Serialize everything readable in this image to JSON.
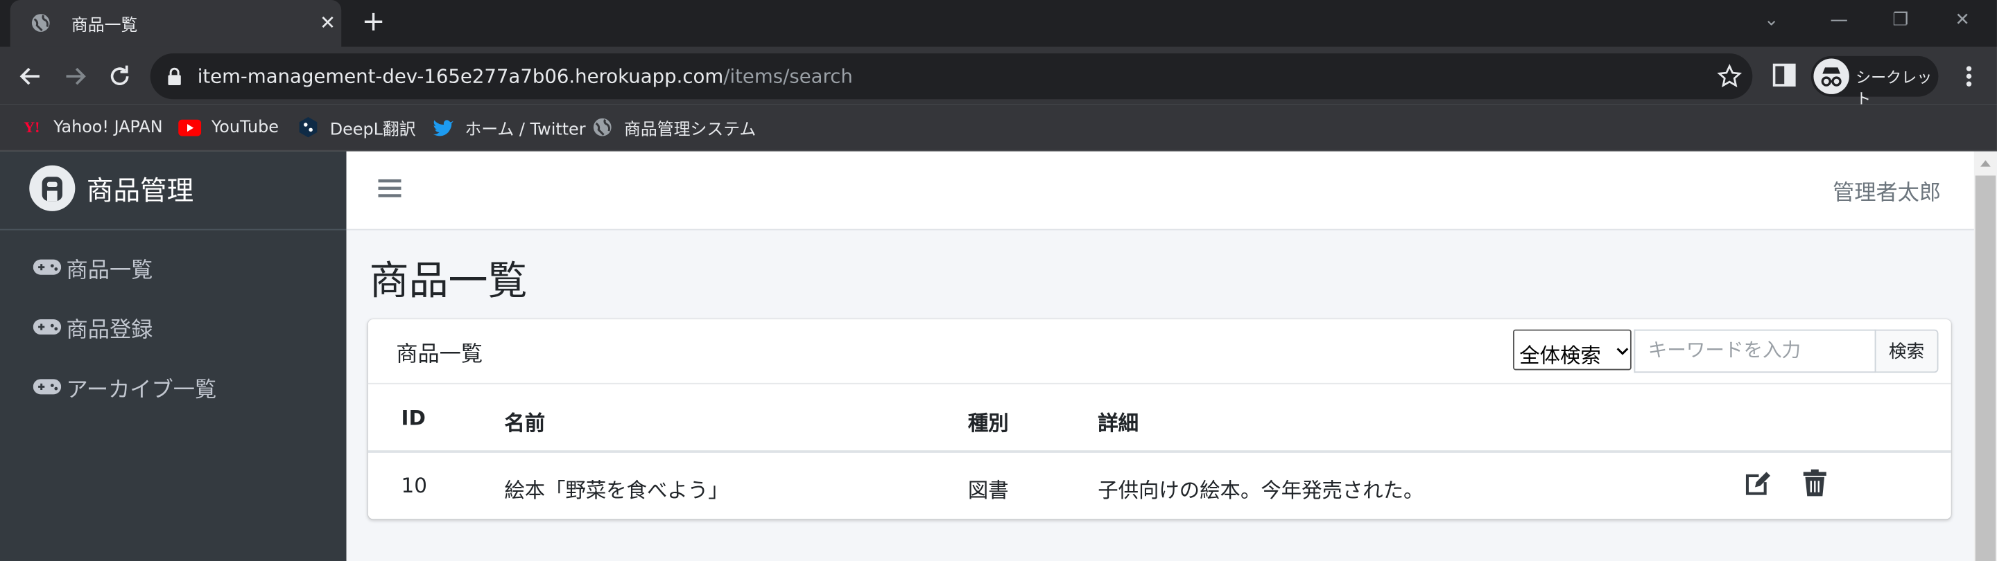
{
  "browser": {
    "tab_title": "商品一覧",
    "url_host": "item-management-dev-165e277a7b06.herokuapp.com",
    "url_path": "/items/search",
    "profile_label": "シークレット"
  },
  "bookmarks": [
    {
      "label": "Yahoo! JAPAN",
      "icon": "yahoo-icon"
    },
    {
      "label": "YouTube",
      "icon": "youtube-icon"
    },
    {
      "label": "DeepL翻訳",
      "icon": "deepl-icon"
    },
    {
      "label": "ホーム / Twitter",
      "icon": "twitter-icon"
    },
    {
      "label": "商品管理システム",
      "icon": "globe-icon"
    }
  ],
  "sidebar": {
    "brand": "商品管理",
    "items": [
      {
        "label": "商品一覧",
        "icon": "gamepad-icon"
      },
      {
        "label": "商品登録",
        "icon": "gamepad-icon"
      },
      {
        "label": "アーカイブ一覧",
        "icon": "gamepad-icon"
      }
    ]
  },
  "header": {
    "user_name": "管理者太郎"
  },
  "main": {
    "page_title": "商品一覧",
    "card_title": "商品一覧",
    "search": {
      "scope_selected": "全体検索",
      "keyword_value": "",
      "keyword_placeholder": "キーワードを入力",
      "button_label": "検索"
    },
    "table": {
      "columns": [
        "ID",
        "名前",
        "種別",
        "詳細"
      ],
      "rows": [
        {
          "id": "10",
          "name": "絵本「野菜を食べよう」",
          "type": "図書",
          "detail": "子供向けの絵本。今年発売された。"
        }
      ]
    }
  },
  "colors": {
    "sidebar_bg": "#343a40",
    "content_bg": "#f4f6f9",
    "browser_bg": "#35363a"
  }
}
